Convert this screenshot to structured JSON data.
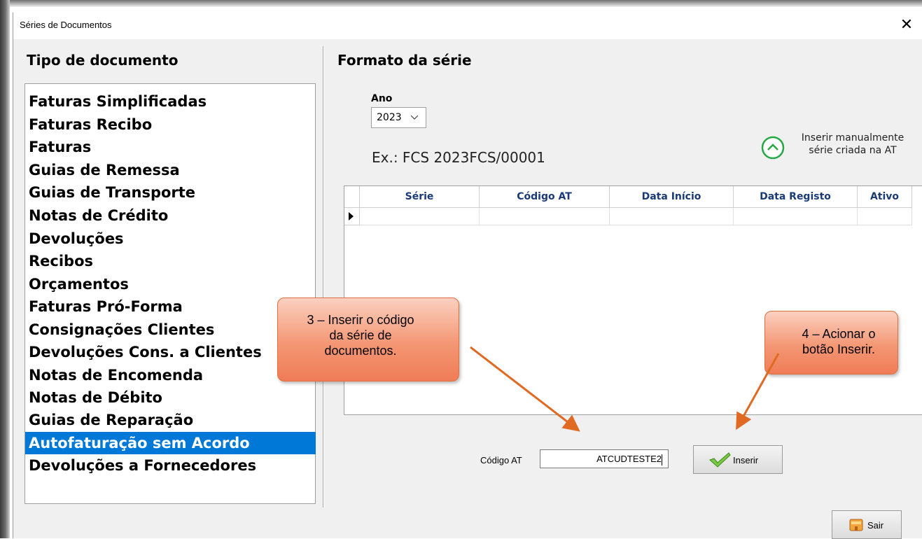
{
  "window": {
    "title": "Séries de Documentos",
    "close_glyph": "✕"
  },
  "left_panel": {
    "title": "Tipo de documento",
    "items": [
      "Faturas Simplificadas",
      "Faturas Recibo",
      "Faturas",
      "Guias de Remessa",
      "Guias de Transporte",
      "Notas de Crédito",
      "Devoluções",
      "Recibos",
      "Orçamentos",
      "Faturas Pró-Forma",
      "Consignações Clientes",
      "Devoluções Cons. a Clientes",
      "Notas de Encomenda",
      "Notas de Débito",
      "Guias de Reparação",
      "Autofaturação sem Acordo",
      "Devoluções a Fornecedores"
    ],
    "selected_index": 15
  },
  "right_panel": {
    "title": "Formato da série",
    "ano_label": "Ano",
    "ano_value": "2023",
    "example": "Ex.:  FCS 2023FCS/00001",
    "manual_line1": "Inserir manualmente",
    "manual_line2": "série criada na AT",
    "grid": {
      "columns": [
        "Série",
        "Código AT",
        "Data Início",
        "Data Registo",
        "Ativo"
      ]
    },
    "codigo_label": "Código AT",
    "codigo_value": "ATCUDTESTE2",
    "inserir_label": "Inserir",
    "sair_label": "Sair"
  },
  "callouts": {
    "step3_line1": "3 – Inserir o código",
    "step3_line2": "da série de",
    "step3_line3": "documentos.",
    "step4_line1": "4 – Acionar o",
    "step4_line2": "botão Inserir."
  },
  "colors": {
    "selection": "#0078d7",
    "grid_header_text": "#1a3a78",
    "callout": "#f49774",
    "arrow": "#e06a22"
  },
  "icons": {
    "manual": "chevron-up-circle-icon",
    "inserir": "checkmark-icon",
    "sair": "exit-door-icon",
    "row": "row-pointer-icon"
  }
}
